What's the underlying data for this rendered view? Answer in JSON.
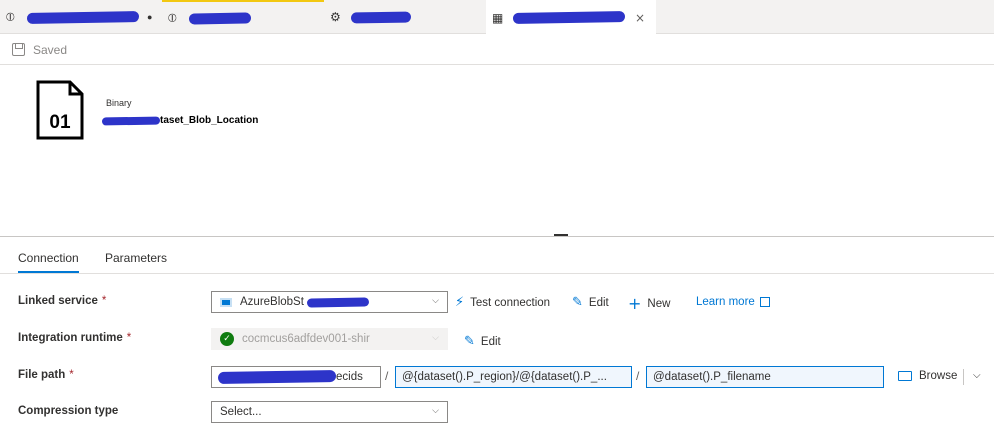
{
  "tabs": [
    {
      "icon": "pipeline-icon",
      "glyph": "⦶",
      "unsaved_marker": "●"
    },
    {
      "icon": "pipeline-icon",
      "glyph": "⦶"
    },
    {
      "icon": "dataflow-icon",
      "glyph": "⚙"
    },
    {
      "icon": "dataset-icon",
      "glyph": "▦",
      "close": "×"
    }
  ],
  "status": {
    "label": "Saved"
  },
  "dataset": {
    "type": "Binary",
    "name_visible": "taset_Blob_Location",
    "icon_text": "01"
  },
  "panel": {
    "tabs": [
      {
        "label": "Connection",
        "active": true
      },
      {
        "label": "Parameters",
        "active": false
      }
    ]
  },
  "form": {
    "linked_service": {
      "label": "Linked service",
      "required_mark": "*",
      "value": "AzureBlobSt",
      "test_connection": "Test connection",
      "edit": "Edit",
      "new": "New",
      "learn_more": "Learn more"
    },
    "integration_runtime": {
      "label": "Integration runtime",
      "required_mark": "*",
      "value": "cocmcus6adfdev001-shir",
      "edit": "Edit"
    },
    "file_path": {
      "label": "File path",
      "required_mark": "*",
      "container_visible": "ecids",
      "directory": "@{dataset().P_region}/@{dataset().P_...",
      "file": "@dataset().P_filename",
      "separator": "/",
      "browse": "Browse"
    },
    "compression_type": {
      "label": "Compression type",
      "value": "Select..."
    }
  },
  "colors": {
    "accent": "#0078d4",
    "required": "#a4262c",
    "success": "#107c10",
    "redaction": "#2d34c9",
    "tab_highlight": "#f2c811"
  }
}
